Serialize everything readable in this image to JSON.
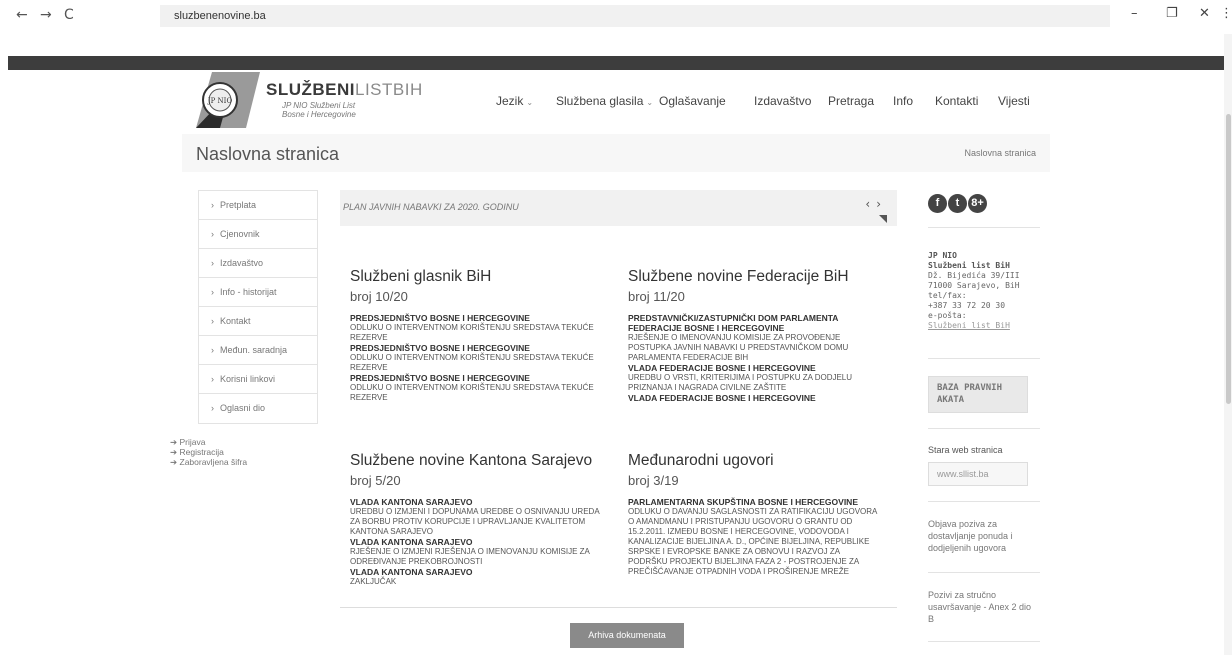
{
  "browser": {
    "url": "sluzbenenovine.ba",
    "back": "←",
    "forward": "→",
    "reload": "C",
    "minimize": "–",
    "restore": "❐",
    "close": "✕",
    "menu": "⋮"
  },
  "brand": {
    "name_bold": "SLUŽBENI",
    "name_light": "LISTBIH",
    "sub_line1": "JP NIO Službeni List",
    "sub_line2": "Bosne i Hercegovine",
    "seal_text": "JP NIO"
  },
  "nav": [
    {
      "label": "Jezik",
      "dropdown": true
    },
    {
      "label": "Službena glasila",
      "dropdown": true
    },
    {
      "label": "Oglašavanje",
      "dropdown": false
    },
    {
      "label": "Izdavaštvo",
      "dropdown": false
    },
    {
      "label": "Pretraga",
      "dropdown": false
    },
    {
      "label": "Info",
      "dropdown": false
    },
    {
      "label": "Kontakti",
      "dropdown": false
    },
    {
      "label": "Vijesti",
      "dropdown": false
    }
  ],
  "page": {
    "title": "Naslovna stranica",
    "breadcrumb": "Naslovna stranica"
  },
  "sidebar": {
    "items": [
      "Pretplata",
      "Cjenovnik",
      "Izdavaštvo",
      "Info - historijat",
      "Kontakt",
      "Međun. saradnja",
      "Korisni linkovi",
      "Oglasni dio"
    ],
    "auth": [
      "Prijava",
      "Registracija",
      "Zaboravljena šifra"
    ]
  },
  "banner": {
    "text": "PLAN JAVNIH NABAVKI ZA 2020. GODINU",
    "prev": "‹",
    "next": "›"
  },
  "journals": [
    {
      "title": "Službeni glasnik BiH",
      "issue": "broj 10/20",
      "entries": [
        {
          "pub": "PREDSJEDNIŠTVO BOSNE I HERCEGOVINE",
          "desc": "ODLUKU O INTERVENTNOM KORIŠTENJU SREDSTAVA TEKUĆE REZERVE"
        },
        {
          "pub": "PREDSJEDNIŠTVO BOSNE I HERCEGOVINE",
          "desc": "ODLUKU O INTERVENTNOM KORIŠTENJU SREDSTAVA TEKUĆE REZERVE"
        },
        {
          "pub": "PREDSJEDNIŠTVO BOSNE I HERCEGOVINE",
          "desc": "ODLUKU O INTERVENTNOM KORIŠTENJU SREDSTAVA TEKUĆE REZERVE"
        }
      ]
    },
    {
      "title": "Službene novine Federacije BiH",
      "issue": "broj 11/20",
      "entries": [
        {
          "pub": "PREDSTAVNIČKI/ZASTUPNIČKI DOM PARLAMENTA FEDERACIJE BOSNE I HERCEGOVINE",
          "desc": "RJEŠENJE O IMENOVANJU KOMISIJE ZA PROVOĐENJE POSTUPKA JAVNIH NABAVKI U PREDSTAVNIČKOM DOMU PARLAMENTA FEDERACIJE BIH"
        },
        {
          "pub": "VLADA FEDERACIJE BOSNE I HERCEGOVINE",
          "desc": "UREDBU O VRSTI, KRITERIJIMA I POSTUPKU ZA DODJELU PRIZNANJA I NAGRADA CIVILNE ZAŠTITE"
        },
        {
          "pub": "VLADA FEDERACIJE BOSNE I HERCEGOVINE",
          "desc": ""
        }
      ]
    },
    {
      "title": "Službene novine Kantona Sarajevo",
      "issue": "broj 5/20",
      "entries": [
        {
          "pub": "VLADA KANTONA SARAJEVO",
          "desc": "UREDBU O IZMJENI I DOPUNAMA UREDBE O OSNIVANJU UREDA ZA BORBU PROTIV KORUPCIJE I UPRAVLJANJE KVALITETOM KANTONA SARAJEVO"
        },
        {
          "pub": "VLADA KANTONA SARAJEVO",
          "desc": "RJEŠENJE O IZMJENI RJEŠENJA O IMENOVANJU KOMISIJE ZA ODREĐIVANJE PREKOBROJNOSTI"
        },
        {
          "pub": "VLADA KANTONA SARAJEVO",
          "desc": "ZAKLJUČAK"
        }
      ]
    },
    {
      "title": "Međunarodni ugovori",
      "issue": "broj 3/19",
      "entries": [
        {
          "pub": "PARLAMENTARNA SKUPŠTINA BOSNE I HERCEGOVINE",
          "desc": "ODLUKU O DAVANJU SAGLASNOSTI ZA RATIFIKACIJU UGOVORA O AMANDMANU I PRISTUPANJU UGOVORU O GRANTU OD 15.2.2011. IZMEĐU BOSNE I HERCEGOVINE, VODOVODA I KANALIZACIJE BIJELJINA A. D., OPĆINE BIJELJINA, REPUBLIKE SRPSKE I EVROPSKE BANKE ZA OBNOVU I RAZVOJ ZA PODRŠKU PROJEKTU BIJELJINA FAZA 2 - POSTROJENJE ZA PREČIŠĆAVANJE OTPADNIH VODA I PROŠIRENJE MREŽE"
        }
      ]
    }
  ],
  "archive_button": "Arhiva dokumenata",
  "right": {
    "social": [
      "f",
      "t",
      "8+"
    ],
    "org": "JP NIO",
    "org_name": "Službeni list BiH",
    "address1": "Dž. Bijedića 39/III",
    "address2": "71000 Sarajevo, BiH",
    "tel_label": "tel/fax:",
    "tel": "+387 33 72 20 30",
    "email_label": "e-pošta:",
    "email_link": "Službeni list BiH",
    "baza": "BAZA PRAVNIH AKATA",
    "old_site_label": "Stara web stranica",
    "old_site_value": "www.sllist.ba",
    "note1": "Objava poziva za dostavljanje ponuda i dodjeljenih ugovora",
    "note2": "Pozivi za stručno usavršavanje - Anex 2 dio B"
  }
}
